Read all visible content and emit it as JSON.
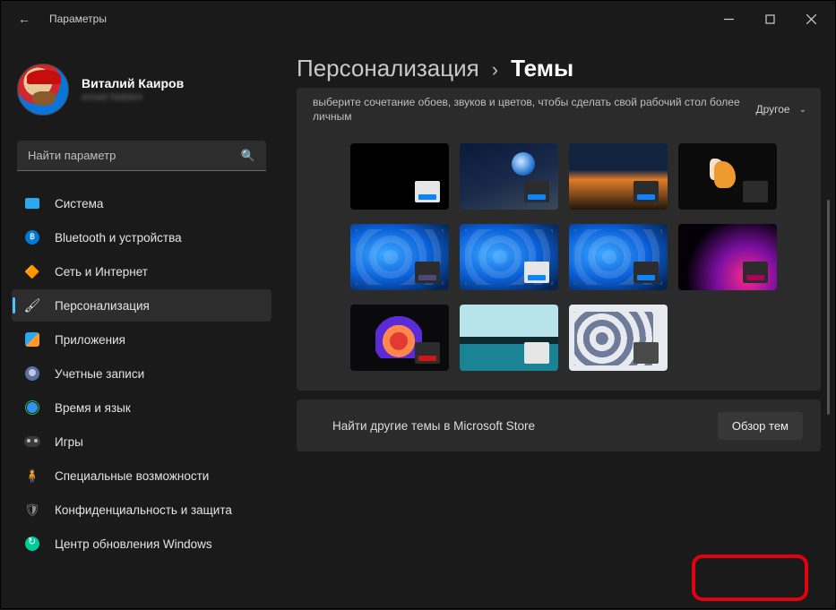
{
  "window": {
    "title": "Параметры"
  },
  "user": {
    "name": "Виталий Каиров",
    "email": "email hidden"
  },
  "search": {
    "placeholder": "Найти параметр"
  },
  "nav": {
    "items": [
      {
        "label": "Система"
      },
      {
        "label": "Bluetooth и устройства"
      },
      {
        "label": "Сеть и Интернет"
      },
      {
        "label": "Персонализация"
      },
      {
        "label": "Приложения"
      },
      {
        "label": "Учетные записи"
      },
      {
        "label": "Время и язык"
      },
      {
        "label": "Игры"
      },
      {
        "label": "Специальные возможности"
      },
      {
        "label": "Конфиденциальность и защита"
      },
      {
        "label": "Центр обновления Windows"
      }
    ],
    "activeIndex": 3
  },
  "breadcrumb": {
    "parent": "Персонализация",
    "sep": "›",
    "current": "Темы"
  },
  "themesPanel": {
    "description": "выберите сочетание обоев, звуков и цветов, чтобы сделать свой рабочий стол более личным",
    "otherLabel": "Другое",
    "themes": [
      {
        "name": "dark-solid",
        "swatchBg": "#e6e6e6",
        "accent": "#0a84ff"
      },
      {
        "name": "earth-moon",
        "swatchBg": "#2c2c2c",
        "accent": "#0a84ff"
      },
      {
        "name": "sunset-road",
        "swatchBg": "#2c2c2c",
        "accent": "#0a84ff"
      },
      {
        "name": "orange-feather",
        "swatchBg": "#2c2c2c",
        "accent": "#2c2c2c"
      },
      {
        "name": "bloom-dark",
        "swatchBg": "#2c2c2c",
        "accent": "#4a4a7a"
      },
      {
        "name": "bloom-light",
        "swatchBg": "#e6e6e6",
        "accent": "#0a84ff"
      },
      {
        "name": "bloom-darkblue",
        "swatchBg": "#2c2c2c",
        "accent": "#0a84ff"
      },
      {
        "name": "pink-glow",
        "swatchBg": "#2c2c2c",
        "accent": "#b1005c"
      },
      {
        "name": "flower-dark",
        "swatchBg": "#2c2c2c",
        "accent": "#d01515"
      },
      {
        "name": "lake",
        "swatchBg": "#e6e6e6",
        "accent": "#e6e6e6"
      },
      {
        "name": "bloom-white",
        "swatchBg": "#4a4a4a",
        "accent": "#4a4a4a"
      }
    ]
  },
  "storeRow": {
    "label": "Найти другие темы в Microsoft Store",
    "button": "Обзор тем"
  }
}
